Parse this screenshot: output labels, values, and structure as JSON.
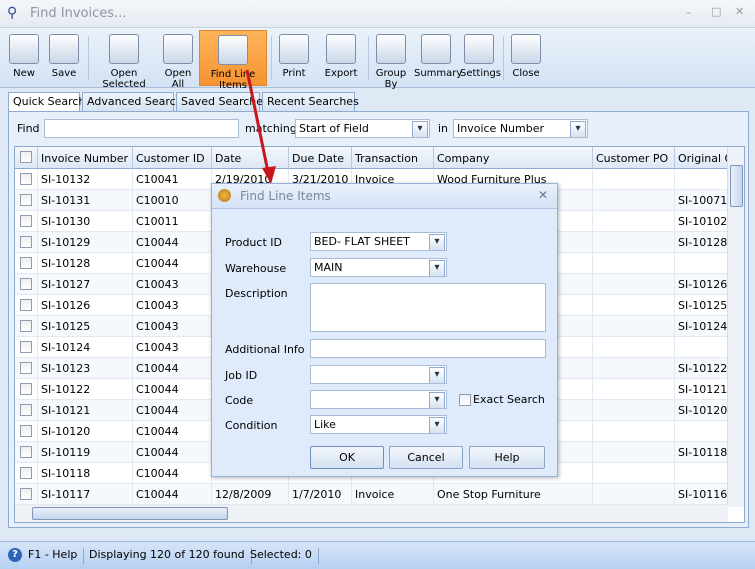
{
  "window": {
    "title": "Find Invoices..."
  },
  "toolbar": [
    {
      "label": "New",
      "icon": "new-document-icon"
    },
    {
      "label": "Save",
      "icon": "floppy-disk-icon"
    },
    {
      "label": "Open Selected",
      "icon": "open-selected-icon"
    },
    {
      "label": "Open All",
      "icon": "open-all-icon"
    },
    {
      "label": "Find Line Items",
      "icon": "binoculars-icon",
      "active": true
    },
    {
      "label": "Print",
      "icon": "printer-icon"
    },
    {
      "label": "Export",
      "icon": "export-icon"
    },
    {
      "label": "Group By",
      "icon": "group-by-icon"
    },
    {
      "label": "Summary",
      "icon": "summary-icon"
    },
    {
      "label": "Settings",
      "icon": "settings-icon"
    },
    {
      "label": "Close",
      "icon": "close-window-icon"
    }
  ],
  "tabs": [
    "Quick Search",
    "Advanced Search",
    "Saved Searches",
    "Recent Searches"
  ],
  "search": {
    "find_label": "Find",
    "find_value": "",
    "matching_label": "matching",
    "matching_value": "Start of Field",
    "in_label": "in",
    "in_value": "Invoice Number"
  },
  "grid": {
    "columns": [
      "Invoice Number",
      "Customer ID",
      "Date",
      "Due Date",
      "Transaction",
      "Company",
      "Customer PO",
      "Original Or"
    ],
    "rows": [
      [
        "SI-10132",
        "C10041",
        "2/19/2010",
        "3/21/2010",
        "Invoice",
        "Wood Furniture Plus",
        "",
        ""
      ],
      [
        "SI-10131",
        "C10010",
        "",
        "",
        "",
        "",
        "",
        "SI-10071"
      ],
      [
        "SI-10130",
        "C10011",
        "",
        "",
        "",
        "",
        "",
        "SI-10102"
      ],
      [
        "SI-10129",
        "C10044",
        "",
        "",
        "",
        "",
        "",
        "SI-10128"
      ],
      [
        "SI-10128",
        "C10044",
        "",
        "",
        "",
        "",
        "",
        ""
      ],
      [
        "SI-10127",
        "C10043",
        "",
        "",
        "",
        "",
        "",
        "SI-10126"
      ],
      [
        "SI-10126",
        "C10043",
        "",
        "",
        "",
        "",
        "",
        "SI-10125"
      ],
      [
        "SI-10125",
        "C10043",
        "",
        "",
        "",
        "",
        "",
        "SI-10124"
      ],
      [
        "SI-10124",
        "C10043",
        "",
        "",
        "",
        "",
        "",
        ""
      ],
      [
        "SI-10123",
        "C10044",
        "",
        "",
        "",
        "",
        "",
        "SI-10122"
      ],
      [
        "SI-10122",
        "C10044",
        "",
        "",
        "",
        "",
        "",
        "SI-10121"
      ],
      [
        "SI-10121",
        "C10044",
        "",
        "",
        "",
        "",
        "",
        "SI-10120"
      ],
      [
        "SI-10120",
        "C10044",
        "",
        "",
        "",
        "",
        "",
        ""
      ],
      [
        "SI-10119",
        "C10044",
        "",
        "",
        "",
        "",
        "",
        "SI-10118"
      ],
      [
        "SI-10118",
        "C10044",
        "",
        "",
        "",
        "",
        "",
        ""
      ],
      [
        "SI-10117",
        "C10044",
        "12/8/2009",
        "1/7/2010",
        "Invoice",
        "One Stop Furniture",
        "",
        "SI-10116"
      ]
    ]
  },
  "dialog": {
    "title": "Find Line Items",
    "product_id_label": "Product ID",
    "product_id_value": "BED- FLAT SHEET",
    "warehouse_label": "Warehouse",
    "warehouse_value": "MAIN",
    "description_label": "Description",
    "description_value": "",
    "additional_info_label": "Additional Info",
    "additional_info_value": "",
    "job_id_label": "Job ID",
    "job_id_value": "",
    "code_label": "Code",
    "code_value": "",
    "exact_search_label": "Exact Search",
    "exact_search_checked": false,
    "condition_label": "Condition",
    "condition_value": "Like",
    "ok": "OK",
    "cancel": "Cancel",
    "help": "Help"
  },
  "status": {
    "help": "F1 - Help",
    "displaying": "Displaying 120 of 120 found",
    "selected": "Selected: 0"
  },
  "colors": {
    "accent": "#f59332",
    "arrow": "#c8161d"
  }
}
